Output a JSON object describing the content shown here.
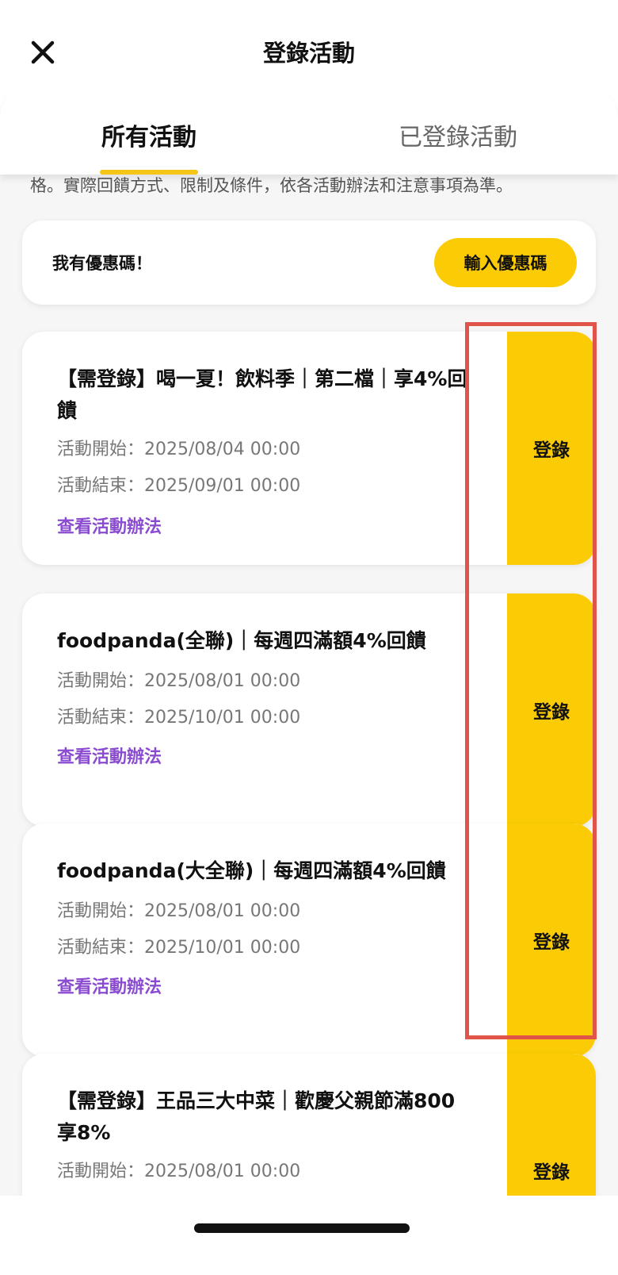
{
  "header": {
    "title": "登錄活動",
    "close_icon": "close-icon"
  },
  "tabs": [
    {
      "label": "所有活動",
      "active": true
    },
    {
      "label": "已登錄活動",
      "active": false
    }
  ],
  "disclaimer": "格。實際回饋方式、限制及條件，依各活動辦法和注意事項為準。",
  "promo": {
    "label": "我有優惠碼！",
    "button": "輸入優惠碼"
  },
  "campaigns": [
    {
      "title": "【需登錄】喝一夏！飲料季｜第二檔｜享4%回饋",
      "start": "活動開始：2025/08/04 00:00",
      "end": "活動結束：2025/09/01 00:00",
      "link": "查看活動辦法",
      "button": "登錄"
    },
    {
      "title": "foodpanda(全聯)｜每週四滿額4%回饋",
      "start": "活動開始：2025/08/01 00:00",
      "end": "活動結束：2025/10/01 00:00",
      "link": "查看活動辦法",
      "button": "登錄"
    },
    {
      "title": "foodpanda(大全聯)｜每週四滿額4%回饋",
      "start": "活動開始：2025/08/01 00:00",
      "end": "活動結束：2025/10/01 00:00",
      "link": "查看活動辦法",
      "button": "登錄"
    },
    {
      "title": "【需登錄】王品三大中菜｜歡慶父親節滿800享8%",
      "start": "活動開始：2025/08/01 00:00",
      "end": "",
      "link": "",
      "button": "登錄"
    }
  ],
  "colors": {
    "accent": "#fbcb05",
    "link": "#8a4bd1",
    "highlight": "#e0544a"
  }
}
